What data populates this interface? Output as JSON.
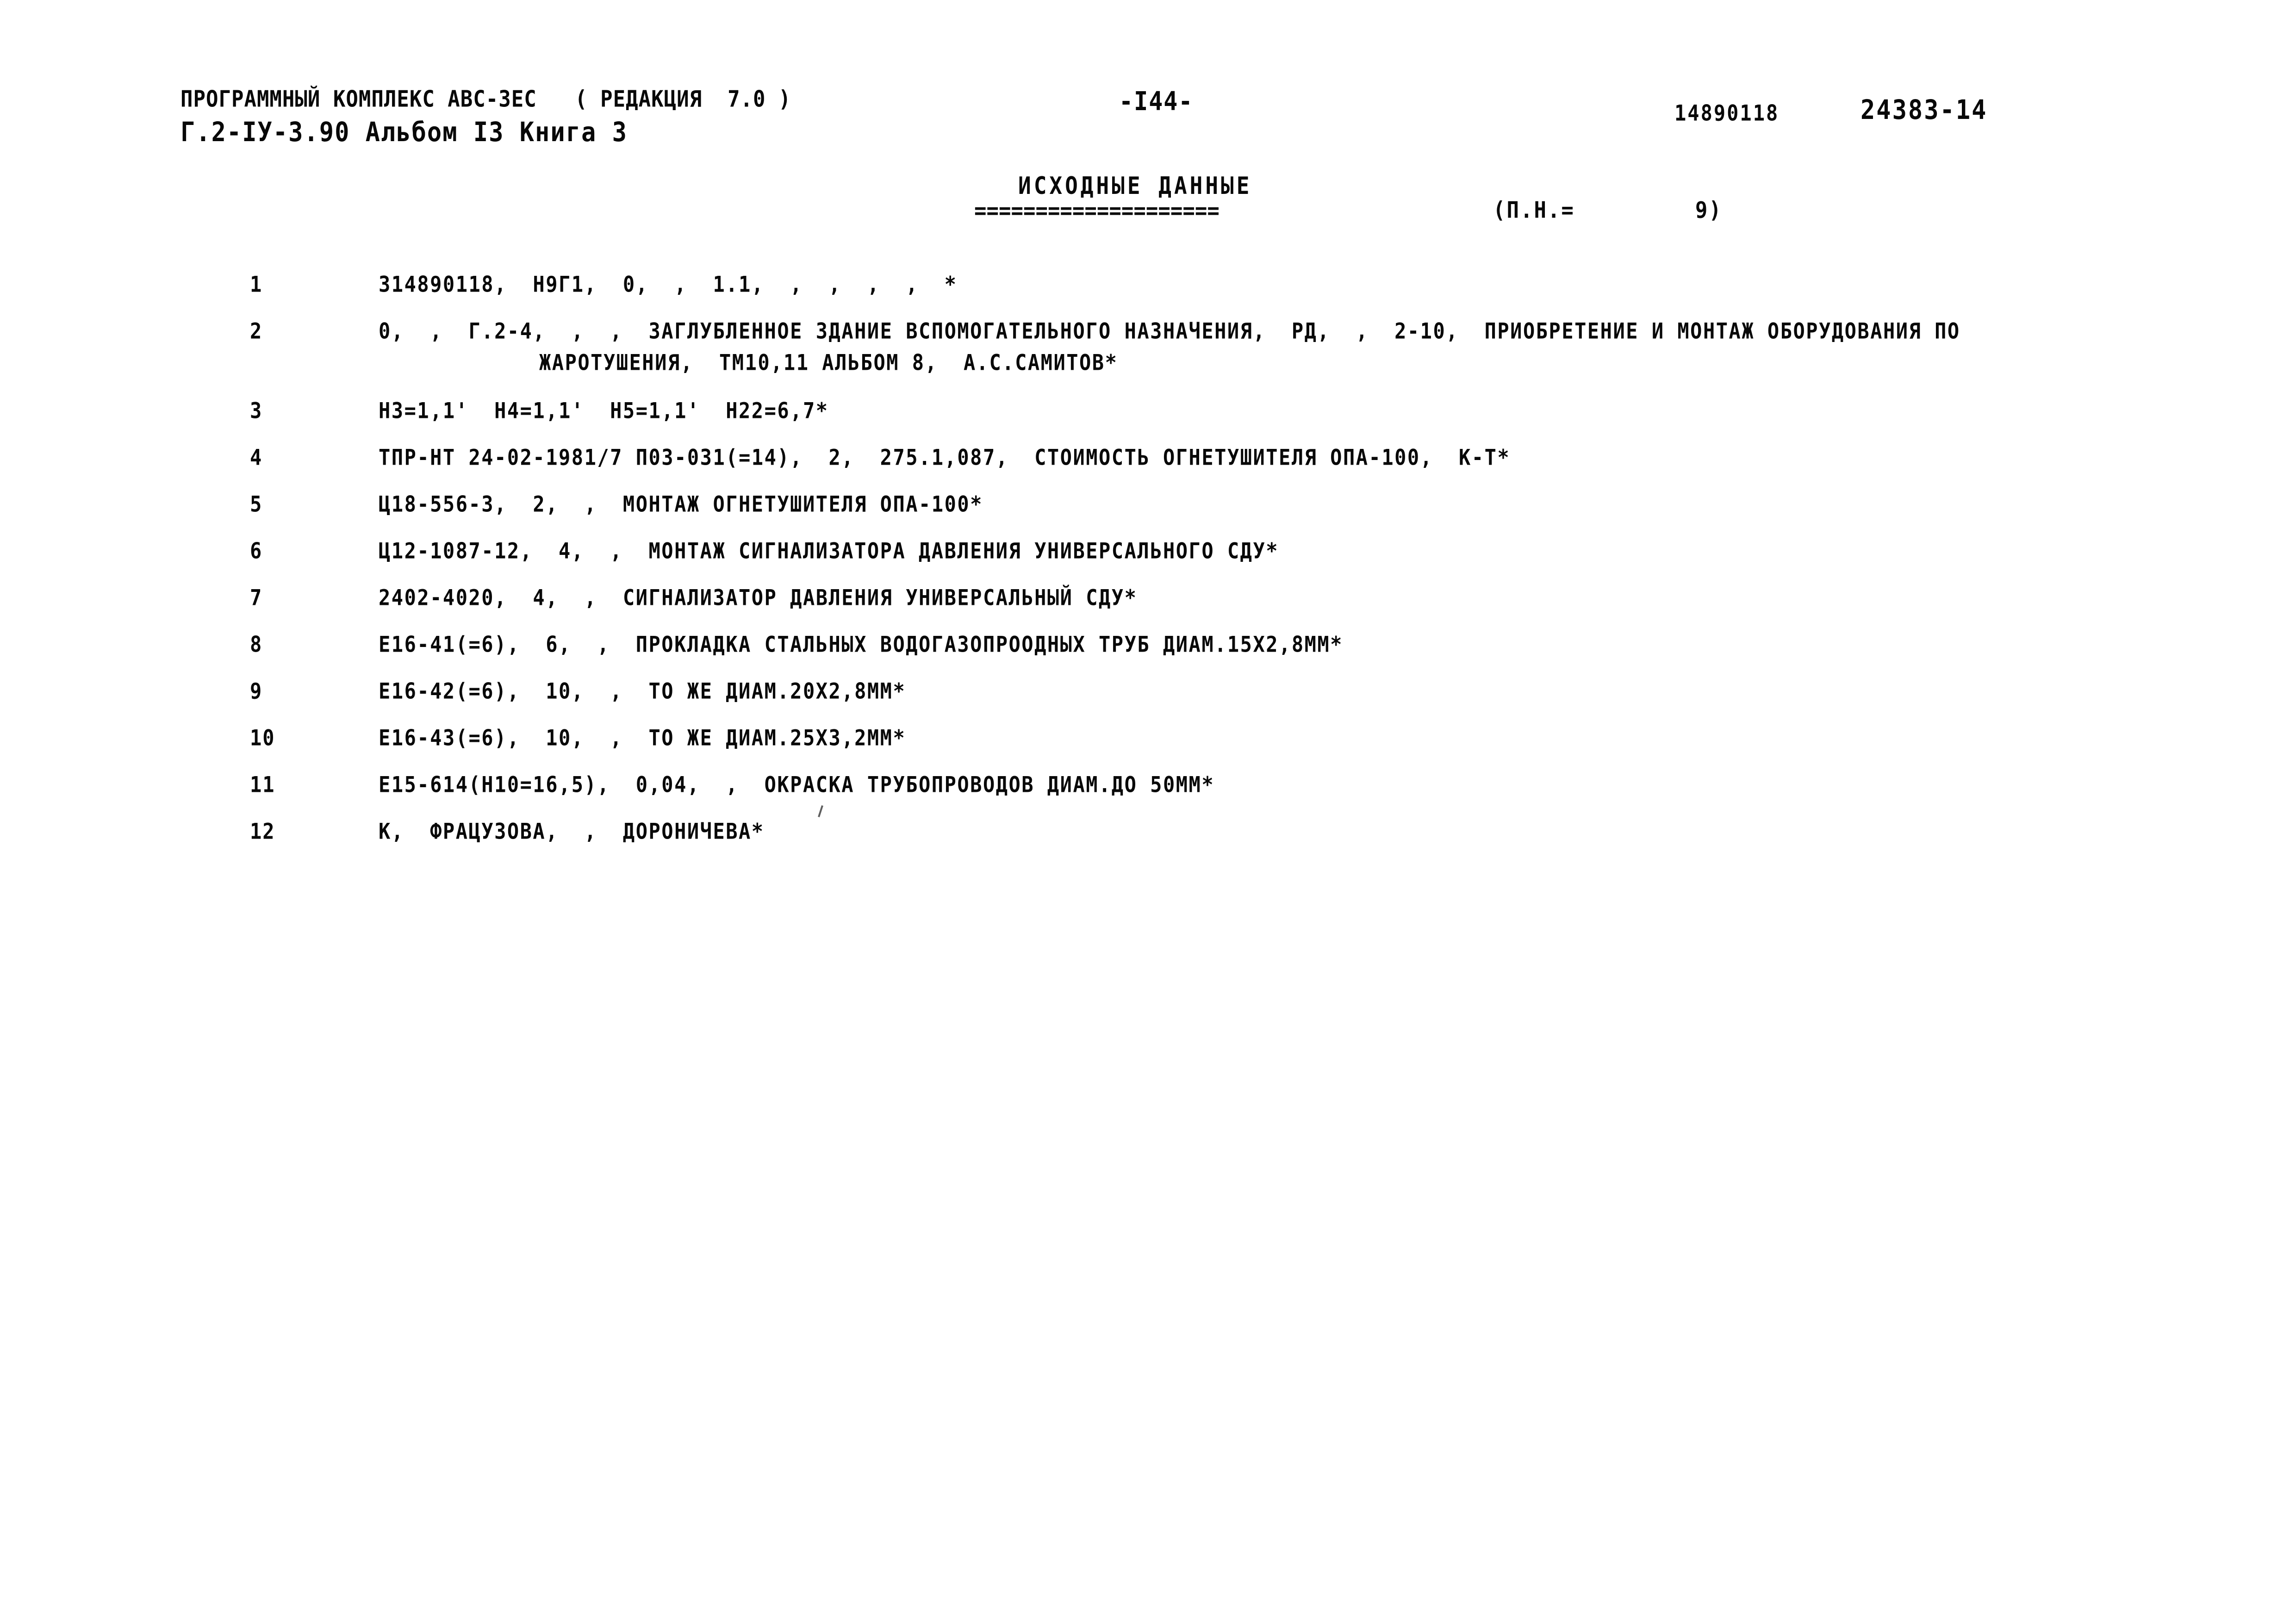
{
  "header": {
    "line1": "ПРОГРАММНЫЙ КОМПЛЕКС АВС-3ЕС   ( РЕДАКЦИЯ  7.0 )",
    "line2": "Г.2-IУ-3.90 Альбом I3 Книга 3",
    "page_number": "-I44-",
    "doc_code": "14890118",
    "sheet_code": "24383-14"
  },
  "section": {
    "title": "ИСХОДНЫЕ ДАННЫЕ",
    "rule": "====================",
    "param_label": "(П.Н.=",
    "param_value": "9)"
  },
  "listing": {
    "rows": [
      {
        "num": "1",
        "text": "314890118,  Н9Г1,  0,  ,  1.1,  ,  ,  ,  ,  *",
        "cont": ""
      },
      {
        "num": "2",
        "text": "0,  ,  Г.2-4,  ,  ,  ЗАГЛУБЛЕННОЕ ЗДАНИЕ ВСПОМОГАТЕЛЬНОГО НАЗНАЧЕНИЯ,  РД,  ,  2-10,  ПРИОБРЕТЕНИЕ И МОНТАЖ ОБОРУДОВАНИЯ ПО",
        "cont": "ЖАРОТУШЕНИЯ,  ТМ10,11 АЛЬБОМ 8,  А.С.САМИТОВ*"
      },
      {
        "num": "3",
        "text": "Н3=1,1'  Н4=1,1'  Н5=1,1'  Н22=6,7*",
        "cont": ""
      },
      {
        "num": "4",
        "text": "ТПР-НТ 24-02-1981/7 П03-031(=14),  2,  275.1,087,  СТОИМОСТЬ ОГНЕТУШИТЕЛЯ ОПА-100,  К-Т*",
        "cont": ""
      },
      {
        "num": "5",
        "text": "Ц18-556-3,  2,  ,  МОНТАЖ ОГНЕТУШИТЕЛЯ ОПА-100*",
        "cont": ""
      },
      {
        "num": "6",
        "text": "Ц12-1087-12,  4,  ,  МОНТАЖ СИГНАЛИЗАТОРА ДАВЛЕНИЯ УНИВЕРСАЛЬНОГО СДУ*",
        "cont": ""
      },
      {
        "num": "7",
        "text": "2402-4020,  4,  ,  СИГНАЛИЗАТОР ДАВЛЕНИЯ УНИВЕРСАЛЬНЫЙ СДУ*",
        "cont": ""
      },
      {
        "num": "8",
        "text": "Е16-41(=6),  6,  ,  ПРОКЛАДКА СТАЛЬНЫХ ВОДОГАЗОПРООДНЫХ ТРУБ ДИАМ.15Х2,8ММ*",
        "cont": ""
      },
      {
        "num": "9",
        "text": "Е16-42(=6),  10,  ,  ТО ЖЕ ДИАМ.20Х2,8ММ*",
        "cont": ""
      },
      {
        "num": "10",
        "text": "Е16-43(=6),  10,  ,  ТО ЖЕ ДИАМ.25Х3,2ММ*",
        "cont": ""
      },
      {
        "num": "11",
        "text": "Е15-614(Н10=16,5),  0,04,  ,  ОКРАСКА ТРУБОПРОВОДОВ ДИАМ.ДО 50ММ*",
        "cont": ""
      },
      {
        "num": "12",
        "text": "К,  ФРАЦУЗОВА,  ,  ДОРОНИЧЕВА*",
        "cont": ""
      }
    ]
  }
}
